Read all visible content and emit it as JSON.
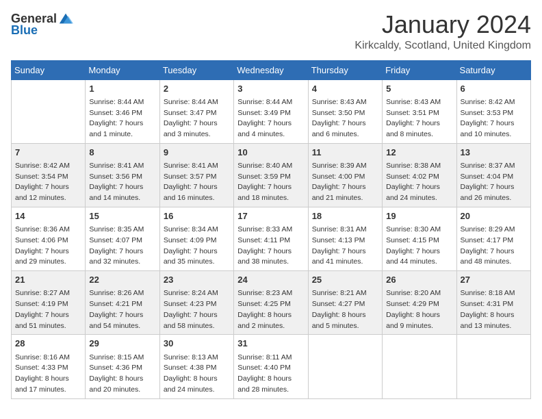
{
  "header": {
    "logo_general": "General",
    "logo_blue": "Blue",
    "month_title": "January 2024",
    "location": "Kirkcaldy, Scotland, United Kingdom"
  },
  "weekdays": [
    "Sunday",
    "Monday",
    "Tuesday",
    "Wednesday",
    "Thursday",
    "Friday",
    "Saturday"
  ],
  "weeks": [
    [
      {
        "day": "",
        "info": ""
      },
      {
        "day": "1",
        "info": "Sunrise: 8:44 AM\nSunset: 3:46 PM\nDaylight: 7 hours\nand 1 minute."
      },
      {
        "day": "2",
        "info": "Sunrise: 8:44 AM\nSunset: 3:47 PM\nDaylight: 7 hours\nand 3 minutes."
      },
      {
        "day": "3",
        "info": "Sunrise: 8:44 AM\nSunset: 3:49 PM\nDaylight: 7 hours\nand 4 minutes."
      },
      {
        "day": "4",
        "info": "Sunrise: 8:43 AM\nSunset: 3:50 PM\nDaylight: 7 hours\nand 6 minutes."
      },
      {
        "day": "5",
        "info": "Sunrise: 8:43 AM\nSunset: 3:51 PM\nDaylight: 7 hours\nand 8 minutes."
      },
      {
        "day": "6",
        "info": "Sunrise: 8:42 AM\nSunset: 3:53 PM\nDaylight: 7 hours\nand 10 minutes."
      }
    ],
    [
      {
        "day": "7",
        "info": "Sunrise: 8:42 AM\nSunset: 3:54 PM\nDaylight: 7 hours\nand 12 minutes."
      },
      {
        "day": "8",
        "info": "Sunrise: 8:41 AM\nSunset: 3:56 PM\nDaylight: 7 hours\nand 14 minutes."
      },
      {
        "day": "9",
        "info": "Sunrise: 8:41 AM\nSunset: 3:57 PM\nDaylight: 7 hours\nand 16 minutes."
      },
      {
        "day": "10",
        "info": "Sunrise: 8:40 AM\nSunset: 3:59 PM\nDaylight: 7 hours\nand 18 minutes."
      },
      {
        "day": "11",
        "info": "Sunrise: 8:39 AM\nSunset: 4:00 PM\nDaylight: 7 hours\nand 21 minutes."
      },
      {
        "day": "12",
        "info": "Sunrise: 8:38 AM\nSunset: 4:02 PM\nDaylight: 7 hours\nand 24 minutes."
      },
      {
        "day": "13",
        "info": "Sunrise: 8:37 AM\nSunset: 4:04 PM\nDaylight: 7 hours\nand 26 minutes."
      }
    ],
    [
      {
        "day": "14",
        "info": "Sunrise: 8:36 AM\nSunset: 4:06 PM\nDaylight: 7 hours\nand 29 minutes."
      },
      {
        "day": "15",
        "info": "Sunrise: 8:35 AM\nSunset: 4:07 PM\nDaylight: 7 hours\nand 32 minutes."
      },
      {
        "day": "16",
        "info": "Sunrise: 8:34 AM\nSunset: 4:09 PM\nDaylight: 7 hours\nand 35 minutes."
      },
      {
        "day": "17",
        "info": "Sunrise: 8:33 AM\nSunset: 4:11 PM\nDaylight: 7 hours\nand 38 minutes."
      },
      {
        "day": "18",
        "info": "Sunrise: 8:31 AM\nSunset: 4:13 PM\nDaylight: 7 hours\nand 41 minutes."
      },
      {
        "day": "19",
        "info": "Sunrise: 8:30 AM\nSunset: 4:15 PM\nDaylight: 7 hours\nand 44 minutes."
      },
      {
        "day": "20",
        "info": "Sunrise: 8:29 AM\nSunset: 4:17 PM\nDaylight: 7 hours\nand 48 minutes."
      }
    ],
    [
      {
        "day": "21",
        "info": "Sunrise: 8:27 AM\nSunset: 4:19 PM\nDaylight: 7 hours\nand 51 minutes."
      },
      {
        "day": "22",
        "info": "Sunrise: 8:26 AM\nSunset: 4:21 PM\nDaylight: 7 hours\nand 54 minutes."
      },
      {
        "day": "23",
        "info": "Sunrise: 8:24 AM\nSunset: 4:23 PM\nDaylight: 7 hours\nand 58 minutes."
      },
      {
        "day": "24",
        "info": "Sunrise: 8:23 AM\nSunset: 4:25 PM\nDaylight: 8 hours\nand 2 minutes."
      },
      {
        "day": "25",
        "info": "Sunrise: 8:21 AM\nSunset: 4:27 PM\nDaylight: 8 hours\nand 5 minutes."
      },
      {
        "day": "26",
        "info": "Sunrise: 8:20 AM\nSunset: 4:29 PM\nDaylight: 8 hours\nand 9 minutes."
      },
      {
        "day": "27",
        "info": "Sunrise: 8:18 AM\nSunset: 4:31 PM\nDaylight: 8 hours\nand 13 minutes."
      }
    ],
    [
      {
        "day": "28",
        "info": "Sunrise: 8:16 AM\nSunset: 4:33 PM\nDaylight: 8 hours\nand 17 minutes."
      },
      {
        "day": "29",
        "info": "Sunrise: 8:15 AM\nSunset: 4:36 PM\nDaylight: 8 hours\nand 20 minutes."
      },
      {
        "day": "30",
        "info": "Sunrise: 8:13 AM\nSunset: 4:38 PM\nDaylight: 8 hours\nand 24 minutes."
      },
      {
        "day": "31",
        "info": "Sunrise: 8:11 AM\nSunset: 4:40 PM\nDaylight: 8 hours\nand 28 minutes."
      },
      {
        "day": "",
        "info": ""
      },
      {
        "day": "",
        "info": ""
      },
      {
        "day": "",
        "info": ""
      }
    ]
  ]
}
